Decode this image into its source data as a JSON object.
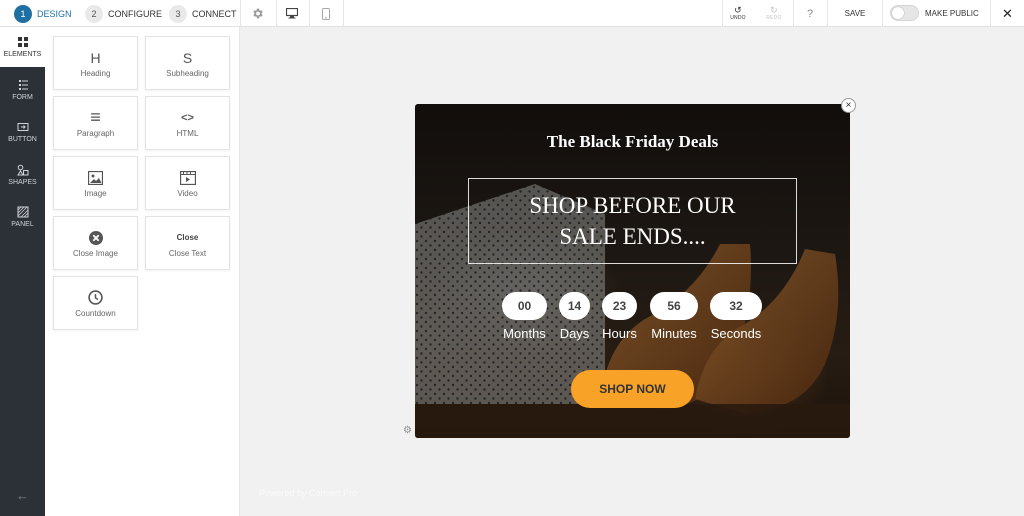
{
  "topbar": {
    "steps": [
      {
        "num": "1",
        "label": "DESIGN"
      },
      {
        "num": "2",
        "label": "CONFIGURE"
      },
      {
        "num": "3",
        "label": "CONNECT"
      }
    ],
    "undo_label": "UNDO",
    "redo_label": "REDO",
    "help_label": "?",
    "save_label": "SAVE",
    "make_public_label": "MAKE PUBLIC",
    "close_label": "✕",
    "accent_color": "#1f6fa3"
  },
  "rail": {
    "items": [
      {
        "label": "ELEMENTS",
        "icon": "grid-icon"
      },
      {
        "label": "FORM",
        "icon": "form-icon"
      },
      {
        "label": "BUTTON",
        "icon": "button-icon"
      },
      {
        "label": "SHAPES",
        "icon": "shapes-icon"
      },
      {
        "label": "PANEL",
        "icon": "panel-icon"
      }
    ],
    "back_label": "←"
  },
  "panel": {
    "tiles": [
      {
        "label": "Heading",
        "glyph": "H"
      },
      {
        "label": "Subheading",
        "glyph": "S"
      },
      {
        "label": "Paragraph",
        "glyph": "≡"
      },
      {
        "label": "HTML",
        "glyph": "<>"
      },
      {
        "label": "Image",
        "glyph": ""
      },
      {
        "label": "Video",
        "glyph": ""
      },
      {
        "label": "Close Image",
        "glyph": "✖"
      },
      {
        "label": "Close Text",
        "glyph": "Close"
      },
      {
        "label": "Countdown",
        "glyph": ""
      }
    ]
  },
  "popup": {
    "title": "The Black Friday Deals",
    "banner": "SHOP BEFORE OUR SALE ENDS....",
    "countdown": [
      {
        "value": "00",
        "label": "Months"
      },
      {
        "value": "14",
        "label": "Days"
      },
      {
        "value": "23",
        "label": "Hours"
      },
      {
        "value": "56",
        "label": "Minutes"
      },
      {
        "value": "32",
        "label": "Seconds"
      }
    ],
    "cta": "SHOP NOW",
    "cta_color": "#f8a227",
    "close_label": "×"
  },
  "canvas": {
    "powered_by": "Powered by Convert Pro"
  }
}
